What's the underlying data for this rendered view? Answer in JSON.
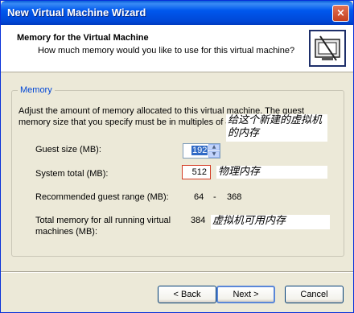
{
  "window": {
    "title": "New Virtual Machine Wizard",
    "close": "×"
  },
  "header": {
    "title": "Memory for the Virtual Machine",
    "subtitle": "How much memory would you like to use for this virtual machine?",
    "icon": "wizard-icon"
  },
  "memory": {
    "group_label": "Memory",
    "description": "Adjust the amount of memory allocated to this virtual machine. The guest memory size that you specify must be in multiples of 4 MB.",
    "guest_size_label": "Guest size (MB):",
    "guest_size_value": "192",
    "system_total_label": "System total (MB):",
    "system_total_value": "512",
    "recommended_label": "Recommended guest range (MB):",
    "recommended_min": "64",
    "recommended_sep": "-",
    "recommended_max": "368",
    "total_running_label": "Total memory for all running virtual machines (MB):",
    "total_running_value": "384"
  },
  "annotations": {
    "note1": "给这个新建的虚拟机的内存",
    "note2": "物理内存",
    "note3": "虚拟机可用内存"
  },
  "buttons": {
    "back": "< Back",
    "next": "Next >",
    "cancel": "Cancel"
  }
}
